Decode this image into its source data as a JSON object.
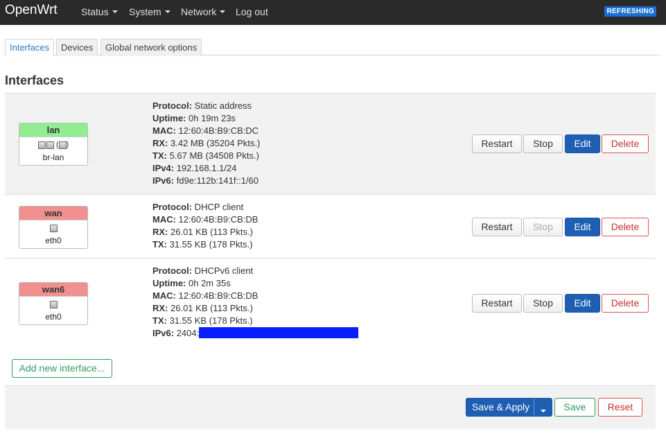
{
  "header": {
    "brand": "OpenWrt",
    "menu": [
      {
        "label": "Status"
      },
      {
        "label": "System"
      },
      {
        "label": "Network"
      },
      {
        "label": "Log out"
      }
    ],
    "indicator": "REFRESHING"
  },
  "tabs": [
    {
      "label": "Interfaces",
      "active": true
    },
    {
      "label": "Devices"
    },
    {
      "label": "Global network options"
    }
  ],
  "page_title": "Interfaces",
  "interfaces": [
    {
      "name": "lan",
      "color": "#90ee90",
      "device": "br-lan",
      "info": [
        {
          "k": "Protocol:",
          "v": " Static address"
        },
        {
          "k": "Uptime:",
          "v": " 0h 19m 23s"
        },
        {
          "k": "MAC:",
          "v": " 12:60:4B:B9:CB:DC"
        },
        {
          "k": "RX:",
          "v": " 3.42 MB (35204 Pkts.)"
        },
        {
          "k": "TX:",
          "v": " 5.67 MB (34508 Pkts.)"
        },
        {
          "k": "IPv4:",
          "v": " 192.168.1.1/24"
        },
        {
          "k": "IPv6:",
          "v": " fd9e:112b:141f::1/60"
        }
      ],
      "buttons": {
        "restart": "Restart",
        "stop": "Stop",
        "edit": "Edit",
        "delete": "Delete"
      }
    },
    {
      "name": "wan",
      "color": "#f09090",
      "device": "eth0",
      "info": [
        {
          "k": "Protocol:",
          "v": " DHCP client"
        },
        {
          "k": "MAC:",
          "v": " 12:60:4B:B9:CB:DB"
        },
        {
          "k": "RX:",
          "v": " 26.01 KB (113 Pkts.)"
        },
        {
          "k": "TX:",
          "v": " 31.55 KB (178 Pkts.)"
        }
      ],
      "buttons": {
        "restart": "Restart",
        "stop": "Stop",
        "edit": "Edit",
        "delete": "Delete"
      }
    },
    {
      "name": "wan6",
      "color": "#f09090",
      "device": "eth0",
      "info": [
        {
          "k": "Protocol:",
          "v": " DHCPv6 client"
        },
        {
          "k": "Uptime:",
          "v": " 0h 2m 35s"
        },
        {
          "k": "MAC:",
          "v": " 12:60:4B:B9:CB:DB"
        },
        {
          "k": "RX:",
          "v": " 26.01 KB (113 Pkts.)"
        },
        {
          "k": "TX:",
          "v": " 31.55 KB (178 Pkts.)"
        },
        {
          "k": "IPv6:",
          "v": " 2404:"
        }
      ],
      "buttons": {
        "restart": "Restart",
        "stop": "Stop",
        "edit": "Edit",
        "delete": "Delete"
      }
    }
  ],
  "add_button": "Add new interface...",
  "footer": {
    "save_apply": "Save & Apply",
    "save": "Save",
    "reset": "Reset"
  }
}
